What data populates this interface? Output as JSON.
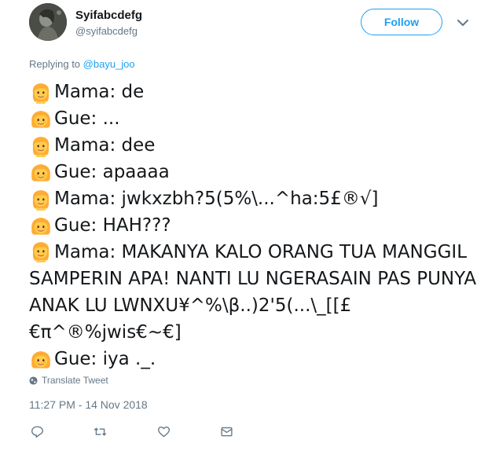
{
  "user": {
    "display_name": "Syifabcdefg",
    "handle": "@syifabcdefg"
  },
  "header": {
    "follow_label": "Follow"
  },
  "replying": {
    "prefix": "Replying to",
    "mention": "@bayu_joo"
  },
  "body_lines": [
    {
      "emoji": "woman-emoji",
      "text": "Mama: de"
    },
    {
      "emoji": "girl-emoji",
      "text": "Gue: ..."
    },
    {
      "emoji": "woman-emoji",
      "text": "Mama: dee"
    },
    {
      "emoji": "girl-emoji",
      "text": "Gue: apaaaa"
    },
    {
      "emoji": "woman-emoji",
      "text": "Mama: jwkxzbh?5(5%\\...^ha:5£®√]"
    },
    {
      "emoji": "girl-emoji",
      "text": "Gue: HAH???"
    },
    {
      "emoji": "woman-emoji",
      "text": "Mama: MAKANYA KALO ORANG TUA MANGGIL SAMPERIN APA! NANTI LU NGERASAIN PAS PUNYA ANAK LU LWNXU¥^%\\β..)2'5(...\\_[[£€π^®%jwis€~€]"
    },
    {
      "emoji": "girl-emoji",
      "text": "Gue: iya ._."
    }
  ],
  "translate_label": "Translate Tweet",
  "timestamp": "11:27 PM - 14 Nov 2018",
  "actions": [
    "reply-icon",
    "retweet-icon",
    "like-icon",
    "message-icon"
  ],
  "colors": {
    "accent": "#1da1f2",
    "muted": "#657786",
    "text": "#14171a",
    "emoji_face": "#ffcc4d",
    "emoji_hair": "#ffac33"
  }
}
